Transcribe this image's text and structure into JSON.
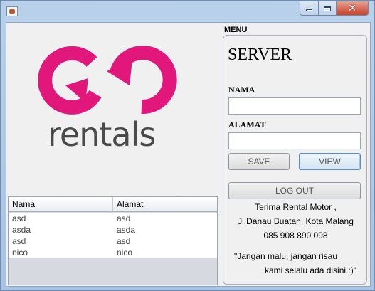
{
  "window": {
    "title": "",
    "close_symbol": "✕"
  },
  "logo": {
    "text": "rentals",
    "colors": {
      "pink": "#e2177c",
      "gray": "#4a4a4a"
    }
  },
  "table": {
    "headers": [
      "Nama",
      "Alamat"
    ],
    "rows": [
      [
        "asd",
        "asd"
      ],
      [
        "asda",
        "asda"
      ],
      [
        "asd",
        "asd"
      ],
      [
        "nico",
        "nico"
      ]
    ]
  },
  "menu": {
    "label": "MENU",
    "title": "SERVER",
    "nama_label": "NAMA",
    "nama_value": "",
    "alamat_label": "ALAMAT",
    "alamat_value": "",
    "save_label": "SAVE",
    "view_label": "VIEW",
    "logout_label": "LOG OUT",
    "info_line1": "Terima Rental Motor ,",
    "info_line2": "Jl.Danau Buatan, Kota Malang",
    "info_line3": "085 908 890 098",
    "quote_line1": "\"Jangan malu, jangan risau",
    "quote_line2": "kami selalu ada disini :)\""
  }
}
